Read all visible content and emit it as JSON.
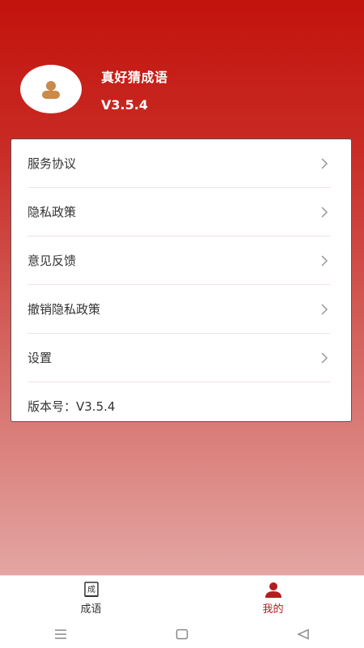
{
  "profile": {
    "app_name": "真好猜成语",
    "version": "V3.5.4"
  },
  "menu": {
    "items": [
      {
        "label": "服务协议"
      },
      {
        "label": "隐私政策"
      },
      {
        "label": "意见反馈"
      },
      {
        "label": "撤销隐私政策"
      },
      {
        "label": "设置"
      }
    ],
    "version_row": "版本号：V3.5.4"
  },
  "tabs": [
    {
      "label": "成语",
      "icon": "book-icon",
      "icon_char": "成"
    },
    {
      "label": "我的",
      "icon": "user-icon"
    }
  ],
  "colors": {
    "brand_red": "#c2130c",
    "active_tab": "#b11e1e"
  }
}
